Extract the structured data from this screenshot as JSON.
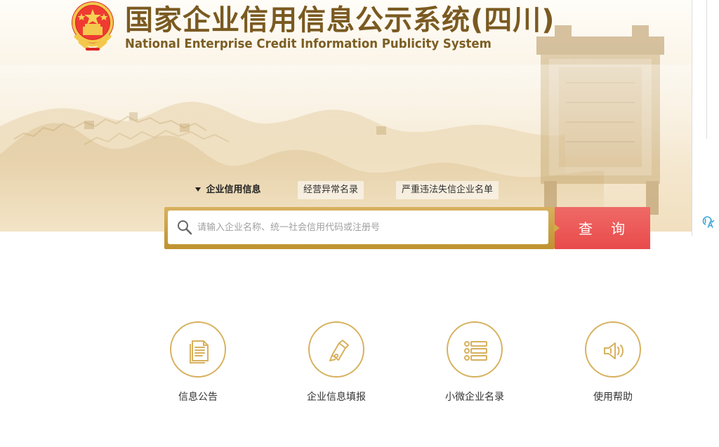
{
  "header": {
    "title_zh": "国家企业信用信息公示系统(四川)",
    "title_en": "National Enterprise Credit Information Publicity System"
  },
  "search": {
    "tabs": [
      {
        "label": "企业信用信息",
        "active": true
      },
      {
        "label": "经营异常名录",
        "active": false
      },
      {
        "label": "严重违法失信企业名单",
        "active": false
      }
    ],
    "placeholder": "请输入企业名称、统一社会信用代码或注册号",
    "button_label": "查 询"
  },
  "quick_links": [
    {
      "label": "信息公告",
      "icon": "document-icon"
    },
    {
      "label": "企业信息填报",
      "icon": "pen-icon"
    },
    {
      "label": "小微企业名录",
      "icon": "list-icon"
    },
    {
      "label": "使用帮助",
      "icon": "speaker-icon"
    }
  ],
  "colors": {
    "gold": "#d7b15e",
    "brown": "#7a5a21",
    "search_button": "#e84b4b"
  }
}
